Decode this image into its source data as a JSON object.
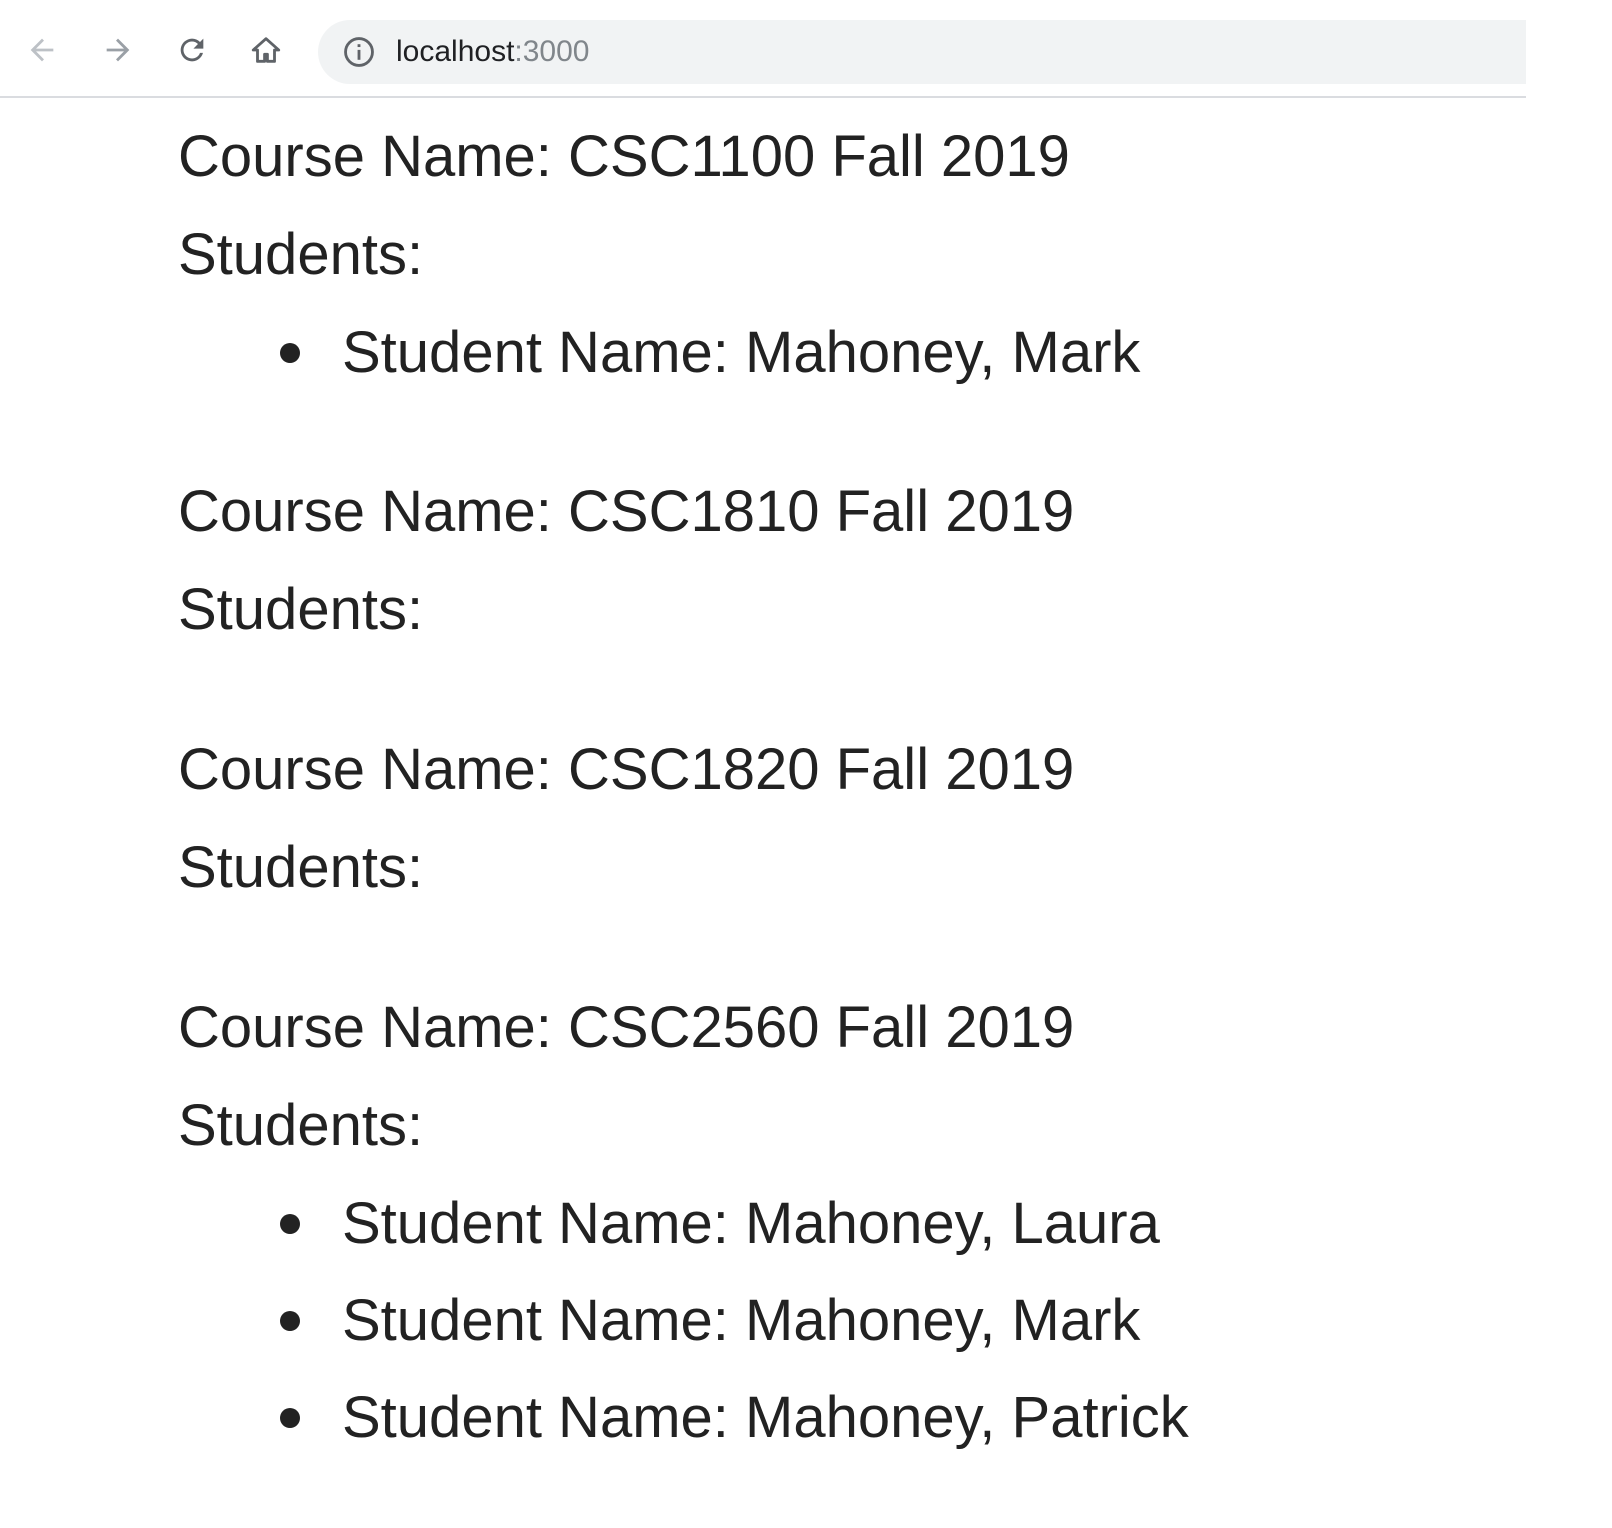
{
  "browser": {
    "url_host": "localhost",
    "url_port": ":3000",
    "back_icon": "back-arrow-icon",
    "forward_icon": "forward-arrow-icon",
    "reload_icon": "reload-icon",
    "home_icon": "home-icon",
    "info_icon": "info-icon"
  },
  "courses": [
    {
      "name": "Course Name: CSC1100 Fall 2019",
      "students_label": "Students:",
      "students": [
        "Student Name: Mahoney, Mark"
      ]
    },
    {
      "name": "Course Name: CSC1810 Fall 2019",
      "students_label": "Students:",
      "students": []
    },
    {
      "name": "Course Name: CSC1820 Fall 2019",
      "students_label": "Students:",
      "students": []
    },
    {
      "name": "Course Name: CSC2560 Fall 2019",
      "students_label": "Students:",
      "students": [
        "Student Name: Mahoney, Laura",
        "Student Name: Mahoney, Mark",
        "Student Name: Mahoney, Patrick"
      ]
    }
  ]
}
